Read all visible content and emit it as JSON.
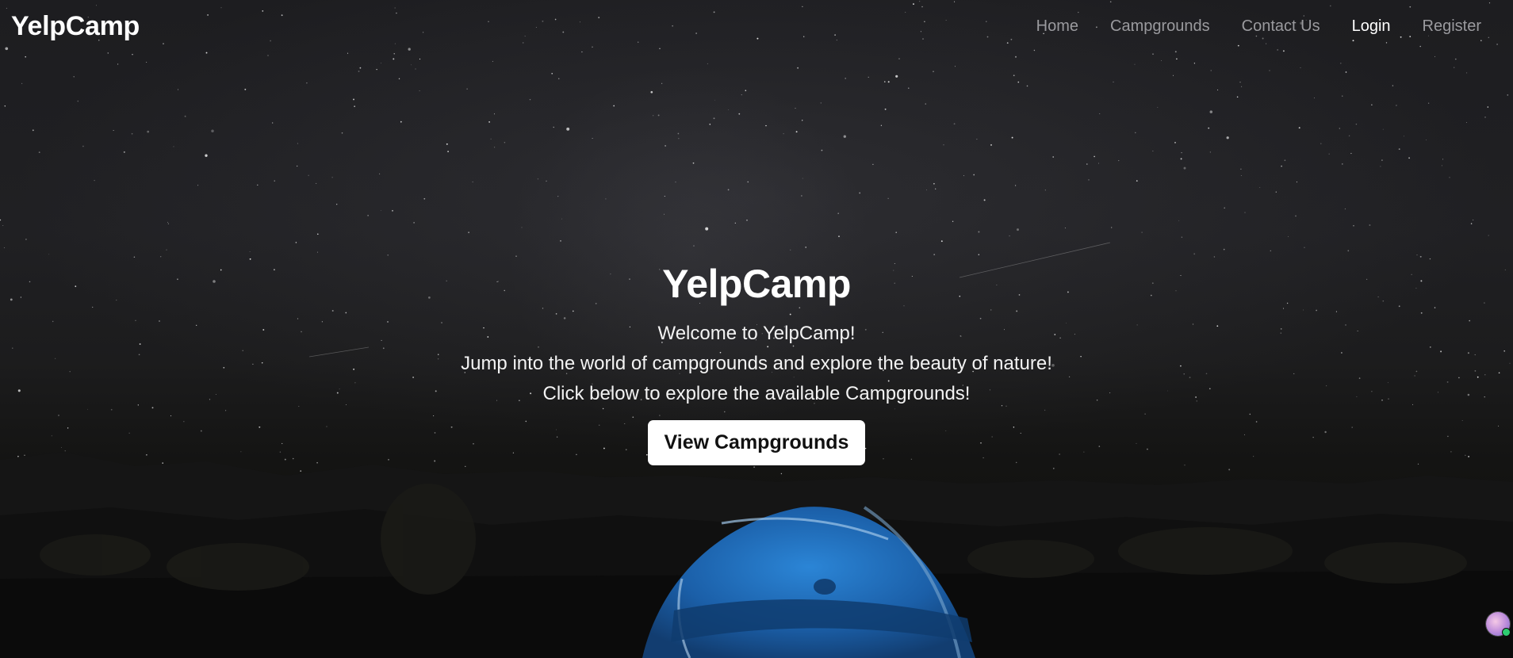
{
  "navbar": {
    "brand": "YelpCamp",
    "links": [
      {
        "label": "Home",
        "active": false
      },
      {
        "label": "Campgrounds",
        "active": false
      },
      {
        "label": "Contact Us",
        "active": false
      },
      {
        "label": "Login",
        "active": true
      },
      {
        "label": "Register",
        "active": false
      }
    ]
  },
  "hero": {
    "title": "YelpCamp",
    "lines": [
      "Welcome to YelpCamp!",
      "Jump into the world of campgrounds and explore the beauty of nature!",
      "Click below to explore the available Campgrounds!"
    ],
    "cta_label": "View Campgrounds"
  },
  "background": {
    "scene": "night-sky-with-tent",
    "sky_color": "#1e1e21",
    "tent_color": "#1e6bb8"
  },
  "icons": {
    "avatar": "user-avatar-icon"
  }
}
